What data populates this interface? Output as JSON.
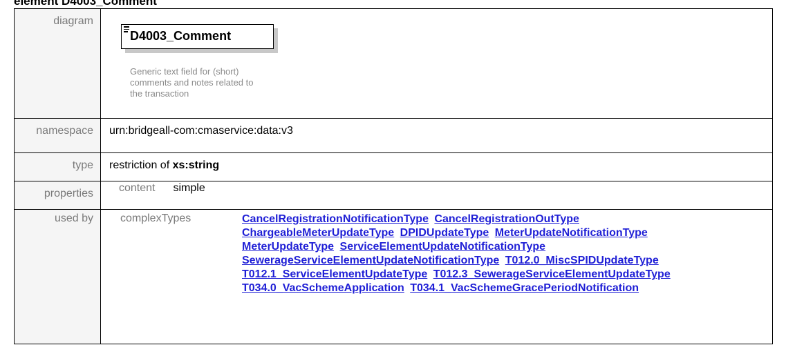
{
  "heading": "element D4003_Comment",
  "rows": {
    "diagram": {
      "label": "diagram",
      "element_name": "D4003_Comment",
      "documentation": "Generic text field for (short) comments and notes related to the transaction"
    },
    "namespace": {
      "label": "namespace",
      "value": "urn:bridgeall-com:cmaservice:data:v3"
    },
    "type": {
      "label": "type",
      "prefix": "restriction of ",
      "value": "xs:string"
    },
    "properties": {
      "label": "properties",
      "key": "content",
      "value": "simple"
    },
    "used_by": {
      "label": "used by",
      "key": "complexTypes",
      "links": [
        "CancelRegistrationNotificationType",
        "CancelRegistrationOutType",
        "ChargeableMeterUpdateType",
        "DPIDUpdateType",
        "MeterUpdateNotificationType",
        "MeterUpdateType",
        "ServiceElementUpdateNotificationType",
        "SewerageServiceElementUpdateNotificationType",
        "T012.0_MiscSPIDUpdateType",
        "T012.1_ServiceElementUpdateType",
        "T012.3_SewerageServiceElementUpdateType",
        "T034.0_VacSchemeApplication",
        "T034.1_VacSchemeGracePeriodNotification"
      ]
    }
  },
  "colors": {
    "link": "#1f1fd6",
    "label": "#7a7a7a",
    "doc_text": "#8a8a8a",
    "shadow": "#c8c8c8"
  }
}
